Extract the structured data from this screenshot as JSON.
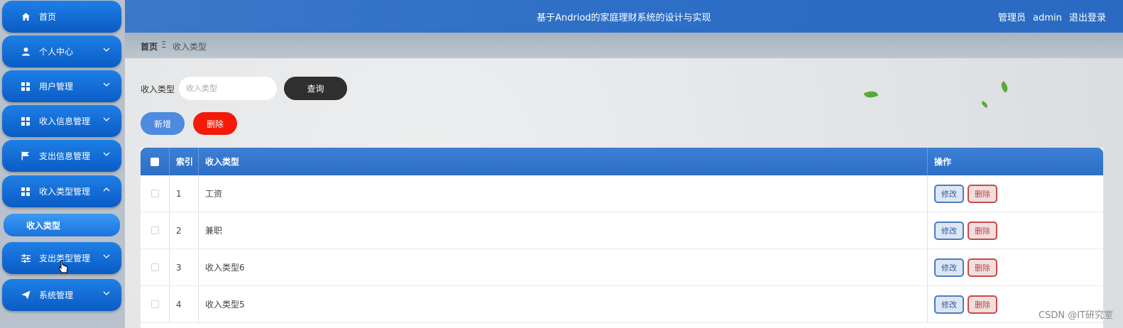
{
  "sidebar": {
    "items": [
      {
        "label": "首页",
        "icon": "home-icon"
      },
      {
        "label": "个人中心",
        "icon": "user-icon"
      },
      {
        "label": "用户管理",
        "icon": "grid-icon"
      },
      {
        "label": "收入信息管理",
        "icon": "grid-icon"
      },
      {
        "label": "支出信息管理",
        "icon": "flag-icon"
      },
      {
        "label": "收入类型管理",
        "icon": "grid-icon"
      },
      {
        "label": "支出类型管理",
        "icon": "sliders-icon"
      },
      {
        "label": "系统管理",
        "icon": "send-icon"
      }
    ],
    "submenu": {
      "label": "收入类型"
    }
  },
  "header": {
    "title": "基于Andriod的家庭理财系统的设计与实现",
    "role": "管理员",
    "username": "admin",
    "logout": "退出登录"
  },
  "breadcrumb": {
    "home": "首页",
    "separator": "Ξ",
    "current": "收入类型"
  },
  "search": {
    "label": "收入类型",
    "placeholder": "收入类型",
    "button": "查询"
  },
  "actions": {
    "add": "新增",
    "delete": "删除"
  },
  "table": {
    "headers": {
      "index": "索引",
      "name": "收入类型",
      "operation": "操作"
    },
    "rows": [
      {
        "index": "1",
        "name": "工资",
        "edit": "修改",
        "delete": "删除"
      },
      {
        "index": "2",
        "name": "兼职",
        "edit": "修改",
        "delete": "删除"
      },
      {
        "index": "3",
        "name": "收入类型6",
        "edit": "修改",
        "delete": "删除"
      },
      {
        "index": "4",
        "name": "收入类型5",
        "edit": "修改",
        "delete": "删除"
      }
    ]
  },
  "watermark": "CSDN @IT研究室",
  "colors": {
    "sidebar_item": "#0a5cc4",
    "header": "#2d6fc6",
    "query_button": "#2f2f2f",
    "add_button": "#4d8ae0",
    "delete_button": "#f41a07"
  }
}
